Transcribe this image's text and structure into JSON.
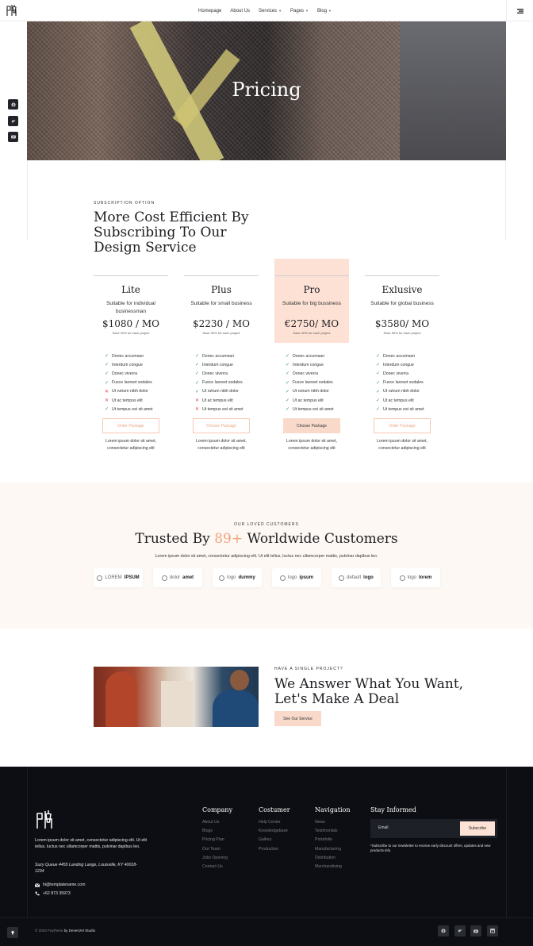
{
  "nav": {
    "items": [
      {
        "label": "Homepage",
        "dropdown": false
      },
      {
        "label": "About Us",
        "dropdown": false
      },
      {
        "label": "Services",
        "dropdown": true
      },
      {
        "label": "Pages",
        "dropdown": true
      },
      {
        "label": "Blog",
        "dropdown": true
      }
    ]
  },
  "social_sidebar": [
    "facebook-icon",
    "twitter-icon",
    "youtube-icon"
  ],
  "hero": {
    "title": "Pricing"
  },
  "pricing": {
    "eyebrow": "SUBSCRIPTION OPTION",
    "title": "More Cost Efficient By Subscribing To Our Design Service",
    "plans": [
      {
        "name": "Lite",
        "subtitle": "Suitable for individual businessman",
        "price": "$1080 / MO",
        "save": "Save 20% for each project",
        "features": [
          [
            "Donec accumsan",
            true
          ],
          [
            "Interdum congue",
            true
          ],
          [
            "Donec viverra",
            true
          ],
          [
            "Fusce laoreet sodales",
            true
          ],
          [
            "Ut rutrum nibh dolor",
            false
          ],
          [
            "Ut ac tempus elit",
            false
          ],
          [
            "Ut tempus est sit amet",
            true
          ]
        ],
        "button": "Order Package",
        "note": "Lorem ipsum dolor sit amet, consectetur adipiscing elit"
      },
      {
        "name": "Plus",
        "subtitle": "Suitable for small business",
        "price": "$2230 / MO",
        "save": "Save 30% for each project",
        "features": [
          [
            "Donec accumsan",
            true
          ],
          [
            "Interdum congue",
            true
          ],
          [
            "Donec viverra",
            true
          ],
          [
            "Fusce laoreet sodales",
            true
          ],
          [
            "Ut rutrum nibh dolor",
            true
          ],
          [
            "Ut ac tempus elit",
            false
          ],
          [
            "Ut tempus est sit amet",
            false
          ]
        ],
        "button": "Choose Package",
        "note": "Lorem ipsum dolor sit amet, consectetur adipiscing elit"
      },
      {
        "name": "Pro",
        "subtitle": "Suitable for big bussiness",
        "price": "€2750/ MO",
        "save": "Save 40% for each project",
        "features": [
          [
            "Donec accumsan",
            true
          ],
          [
            "Interdum congue",
            true
          ],
          [
            "Donec viverra",
            true
          ],
          [
            "Fusce laoreet sodales",
            true
          ],
          [
            "Ut rutrum nibh dolor",
            true
          ],
          [
            "Ut ac tempus elit",
            true
          ],
          [
            "Ut tempus est sit amet",
            true
          ]
        ],
        "button": "Choose Package",
        "note": "Lorem ipsum dolor sit amet, consectetur adipiscing elit"
      },
      {
        "name": "Exlusive",
        "subtitle": "Suitable for global business",
        "price": "$3580/ MO",
        "save": "Save 50% for each project",
        "features": [
          [
            "Donec accumsan",
            true
          ],
          [
            "Interdum congue",
            true
          ],
          [
            "Donec viverra",
            true
          ],
          [
            "Fusce laoreet sodales",
            true
          ],
          [
            "Ut rutrum nibh dolor",
            true
          ],
          [
            "Ut ac tempus elit",
            true
          ],
          [
            "Ut tempus est sit amet",
            true
          ]
        ],
        "button": "Order Package",
        "note": "Lorem ipsum dolor sit amet, consectetur adipiscing elit"
      }
    ]
  },
  "trusted": {
    "eyebrow": "OUR LOVED CUSTOMERS",
    "title_pre": "Trusted By ",
    "title_accent": "89+",
    "title_post": " Worldwide Customers",
    "description": "Lorem ipsum dolor sit amet, consectetur adipiscing elit. Ut elit tellus, luctus nec ullamcorper mattis, pulvinar dapibus leo.",
    "brands": [
      {
        "a": "LOREM",
        "b": "IPSUM"
      },
      {
        "a": "dolor",
        "b": "amet"
      },
      {
        "a": "logo",
        "b": "dummy"
      },
      {
        "a": "logo",
        "b": "ipsum"
      },
      {
        "a": "default",
        "b": "logo"
      },
      {
        "a": "logo",
        "b": "lorem"
      }
    ]
  },
  "cta": {
    "eyebrow": "HAVE A SINGLE PROJECT?",
    "title": "We Answer What You Want, Let's Make A Deal",
    "button": "See Our Service"
  },
  "footer": {
    "description": "Lorem ipsum dolor sit amet, consectetur adipiscing elit. Ut elit tellus, luctus nec ullamcorper mattis, pulvinar dapibus leo.",
    "address": "Suzy Queue 4455 Landing Lange, Louisville, KY 40018-1234",
    "email": "hi@templatename.com",
    "phone": "+62 873 35973",
    "columns": [
      {
        "title": "Company",
        "links": [
          "About Us",
          "Blogs",
          "Pricing Plan",
          "Our Team",
          "Jobs Opening",
          "Contact Us"
        ]
      },
      {
        "title": "Costumer",
        "links": [
          "Help Center",
          "Knowledgebase",
          "Gallery",
          "Production"
        ]
      },
      {
        "title": "Navigation",
        "links": [
          "News",
          "Testimonials",
          "Portafolio",
          "Manufacturing",
          "Distribution",
          "Merchandising"
        ]
      }
    ],
    "newsletter": {
      "title": "Stay Informed",
      "placeholder": "Email",
      "button": "Subscribe",
      "note": "*Subscribe to our newsletter to receive early discount offers, updates and new products info."
    },
    "copyright_pre": "© 2022 Feyrhens",
    "copyright_by": "by Devenzel Studio",
    "social": [
      "facebook-icon",
      "twitter-icon",
      "youtube-icon",
      "linkedin-icon"
    ]
  },
  "colors": {
    "accent": "#f1a47c",
    "pro_bg": "#fde1d4",
    "footer_bg": "#0d0e13"
  }
}
